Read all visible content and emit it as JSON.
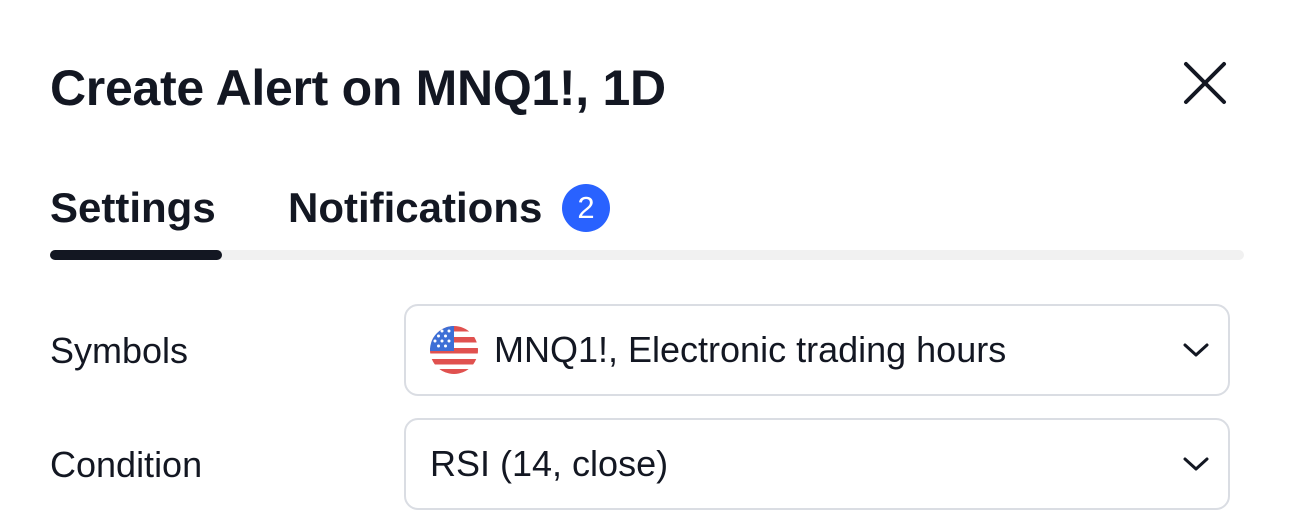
{
  "dialog": {
    "title": "Create Alert on MNQ1!, 1D"
  },
  "tabs": [
    {
      "label": "Settings",
      "active": true
    },
    {
      "label": "Notifications",
      "badge": "2"
    }
  ],
  "form": {
    "symbols": {
      "label": "Symbols",
      "value": "MNQ1!, Electronic trading hours",
      "icon": "us-flag-icon"
    },
    "condition": {
      "label": "Condition",
      "value": "RSI (14, close)"
    }
  },
  "colors": {
    "accent": "#2962ff",
    "text": "#131722",
    "border": "#dadde3",
    "tab_track": "#f1f1f1"
  }
}
